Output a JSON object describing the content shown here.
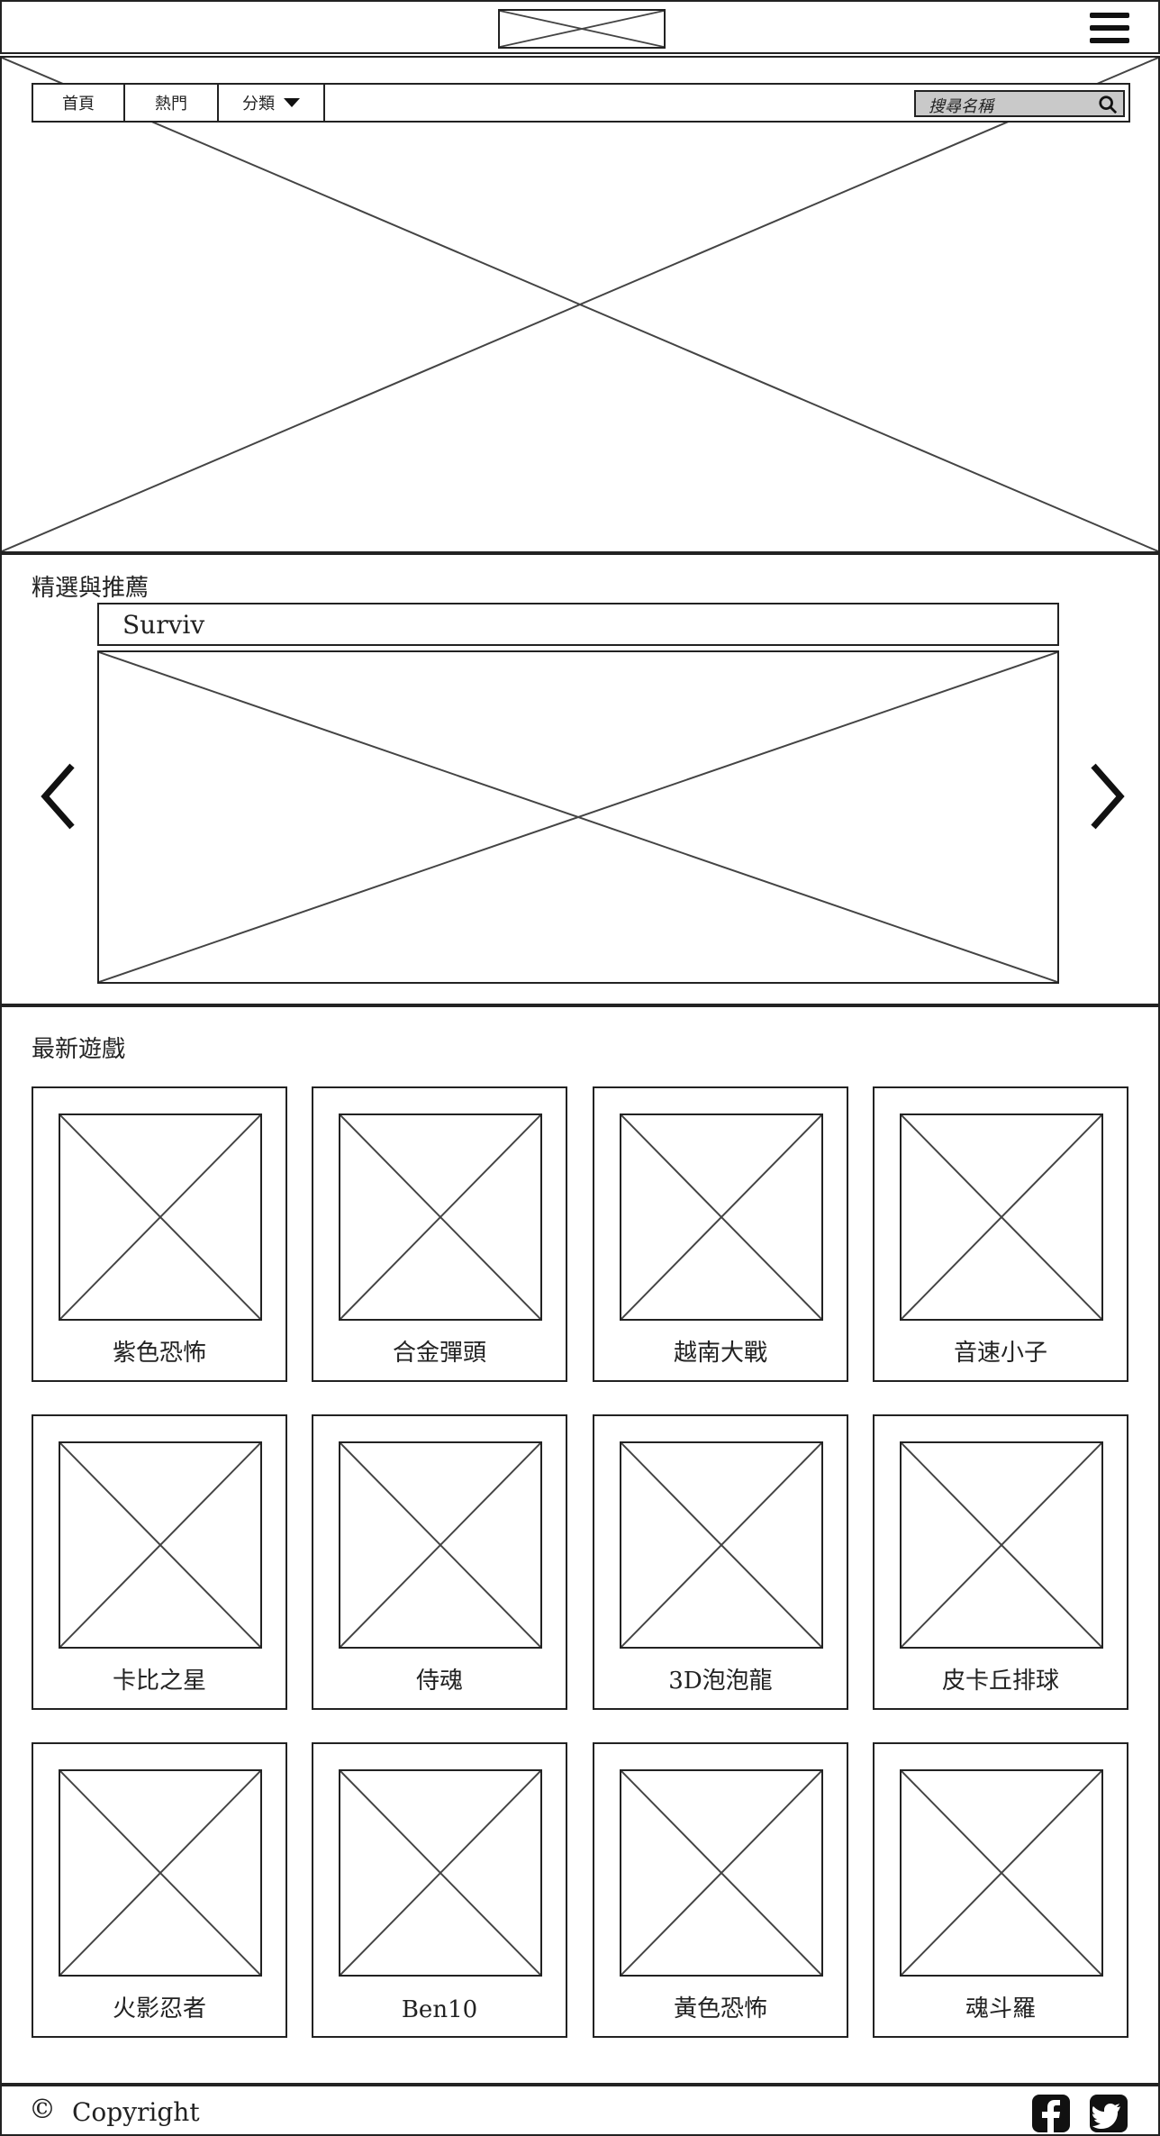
{
  "header": {
    "logo_icon": "logo-placeholder-image",
    "menu_icon": "hamburger-menu-icon"
  },
  "nav": {
    "items": [
      {
        "label": "首頁"
      },
      {
        "label": "熱門"
      },
      {
        "label": "分類",
        "icon": "caret-down-icon"
      }
    ],
    "search": {
      "placeholder": "搜尋名稱",
      "icon": "search-icon"
    }
  },
  "featured": {
    "heading": "精選與推薦",
    "current_title": "Surviv",
    "prev_icon": "chevron-left-icon",
    "next_icon": "chevron-right-icon"
  },
  "latest": {
    "heading": "最新遊戲",
    "games": [
      {
        "name": "紫色恐怖"
      },
      {
        "name": "合金彈頭"
      },
      {
        "name": "越南大戰"
      },
      {
        "name": "音速小子"
      },
      {
        "name": "卡比之星"
      },
      {
        "name": "侍魂"
      },
      {
        "name": "3D泡泡龍"
      },
      {
        "name": "皮卡丘排球"
      },
      {
        "name": "火影忍者"
      },
      {
        "name": "Ben10"
      },
      {
        "name": "黃色恐怖"
      },
      {
        "name": "魂斗羅"
      }
    ]
  },
  "footer": {
    "copyright_symbol": "©",
    "copyright": "Copyright",
    "social_icons": [
      "facebook-icon",
      "twitter-icon"
    ]
  }
}
